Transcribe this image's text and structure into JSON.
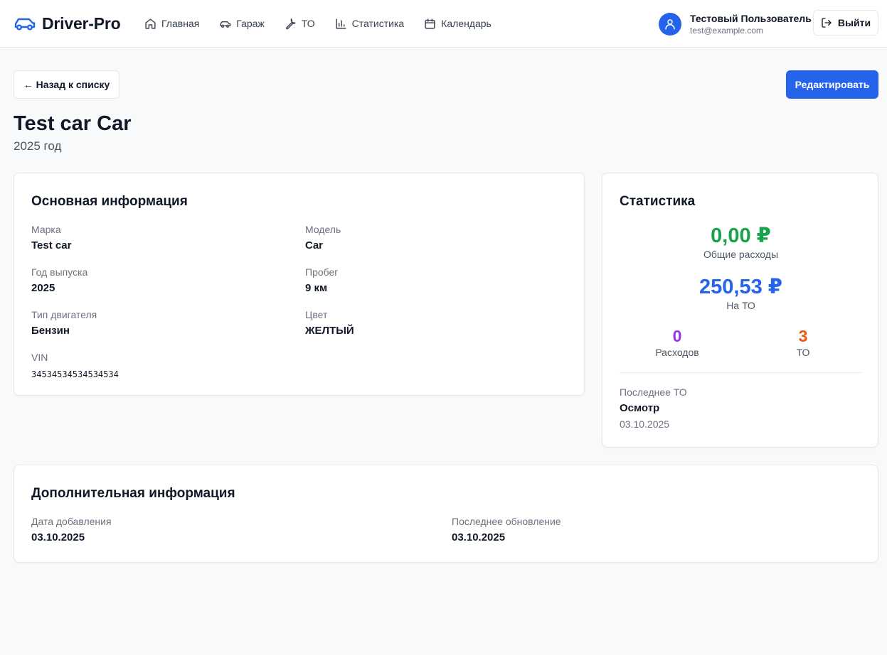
{
  "header": {
    "brand": "Driver-Pro",
    "nav": [
      {
        "label": "Главная",
        "icon": "home-icon"
      },
      {
        "label": "Гараж",
        "icon": "car-icon"
      },
      {
        "label": "ТО",
        "icon": "wrench-icon"
      },
      {
        "label": "Статистика",
        "icon": "bar-chart-icon"
      },
      {
        "label": "Календарь",
        "icon": "calendar-icon"
      }
    ],
    "user": {
      "name": "Тестовый Пользователь",
      "email": "test@example.com"
    },
    "logout_label": "Выйти"
  },
  "actions": {
    "back_label": "← Назад к списку",
    "edit_label": "Редактировать"
  },
  "page": {
    "title": "Test car Car",
    "subtitle": "2025 год"
  },
  "info": {
    "title": "Основная информация",
    "fields": [
      {
        "label": "Марка",
        "value": "Test car"
      },
      {
        "label": "Модель",
        "value": "Car"
      },
      {
        "label": "Год выпуска",
        "value": "2025"
      },
      {
        "label": "Пробег",
        "value": "9 км"
      },
      {
        "label": "Тип двигателя",
        "value": "Бензин"
      },
      {
        "label": "Цвет",
        "value": "ЖЕЛТЫЙ"
      },
      {
        "label": "VIN",
        "value": "34534534534534534"
      }
    ]
  },
  "stats": {
    "title": "Статистика",
    "total_expenses": {
      "value": "0,00 ₽",
      "label": "Общие расходы",
      "color": "#16a34a"
    },
    "maintenance_spend": {
      "value": "250,53 ₽",
      "label": "На ТО",
      "color": "#2563eb"
    },
    "expenses_count": {
      "value": "0",
      "label": "Расходов",
      "color": "#9333ea"
    },
    "maintenance_count": {
      "value": "3",
      "label": "ТО",
      "color": "#ea580c"
    },
    "last_maintenance": {
      "label": "Последнее ТО",
      "name": "Осмотр",
      "date": "03.10.2025"
    }
  },
  "extra": {
    "title": "Дополнительная информация",
    "fields": [
      {
        "label": "Дата добавления",
        "value": "03.10.2025"
      },
      {
        "label": "Последнее обновление",
        "value": "03.10.2025"
      }
    ]
  },
  "colors": {
    "accent": "#2563eb",
    "background": "#f8f9fb"
  }
}
